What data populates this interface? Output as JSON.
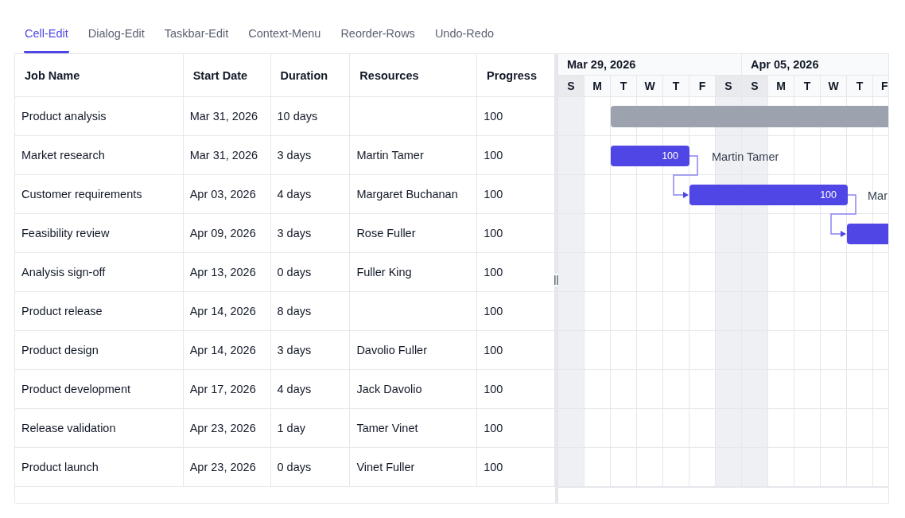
{
  "tabs": [
    {
      "label": "Cell-Edit",
      "selected": true
    },
    {
      "label": "Dialog-Edit",
      "selected": false
    },
    {
      "label": "Taskbar-Edit",
      "selected": false
    },
    {
      "label": "Context-Menu",
      "selected": false
    },
    {
      "label": "Reorder-Rows",
      "selected": false
    },
    {
      "label": "Undo-Redo",
      "selected": false
    }
  ],
  "grid": {
    "columns": [
      "Job Name",
      "Start Date",
      "Duration",
      "Resources",
      "Progress"
    ],
    "rows": [
      {
        "cells": [
          "Product analysis",
          "Mar 31, 2026",
          "10 days",
          "",
          "100"
        ],
        "bar": {
          "kind": "summary"
        }
      },
      {
        "cells": [
          "Market research",
          "Mar 31, 2026",
          "3 days",
          "Martin Tamer",
          "100"
        ],
        "bar": {
          "kind": "task",
          "label": "100",
          "resource_label": "Martin Tamer"
        }
      },
      {
        "cells": [
          "Customer requirements",
          "Apr 03, 2026",
          "4 days",
          "Margaret Buchanan",
          "100"
        ],
        "bar": {
          "kind": "task",
          "label": "100",
          "resource_label": "Mar",
          "linked": true
        }
      },
      {
        "cells": [
          "Feasibility review",
          "Apr 09, 2026",
          "3 days",
          "Rose Fuller",
          "100"
        ],
        "bar": {
          "kind": "task",
          "linked": true
        }
      },
      {
        "cells": [
          "Analysis sign-off",
          "Apr 13, 2026",
          "0 days",
          "Fuller King",
          "100"
        ]
      },
      {
        "cells": [
          "Product release",
          "Apr 14, 2026",
          "8 days",
          "",
          "100"
        ]
      },
      {
        "cells": [
          "Product design",
          "Apr 14, 2026",
          "3 days",
          "Davolio Fuller",
          "100"
        ]
      },
      {
        "cells": [
          "Product development",
          "Apr 17, 2026",
          "4 days",
          "Jack Davolio",
          "100"
        ]
      },
      {
        "cells": [
          "Release validation",
          "Apr 23, 2026",
          "1 day",
          "Tamer Vinet",
          "100"
        ]
      },
      {
        "cells": [
          "Product launch",
          "Apr 23, 2026",
          "0 days",
          "Vinet Fuller",
          "100"
        ]
      }
    ]
  },
  "timeline": {
    "weeks": [
      "Mar 29, 2026",
      "Apr 05, 2026"
    ],
    "days": [
      {
        "label": "S",
        "weekend": true
      },
      {
        "label": "M",
        "weekend": false
      },
      {
        "label": "T",
        "weekend": false
      },
      {
        "label": "W",
        "weekend": false
      },
      {
        "label": "T",
        "weekend": false
      },
      {
        "label": "F",
        "weekend": false
      },
      {
        "label": "S",
        "weekend": true
      },
      {
        "label": "S",
        "weekend": true
      },
      {
        "label": "M",
        "weekend": false
      },
      {
        "label": "T",
        "weekend": false
      },
      {
        "label": "W",
        "weekend": false
      },
      {
        "label": "T",
        "weekend": false
      },
      {
        "label": "F",
        "weekend": false
      }
    ]
  }
}
